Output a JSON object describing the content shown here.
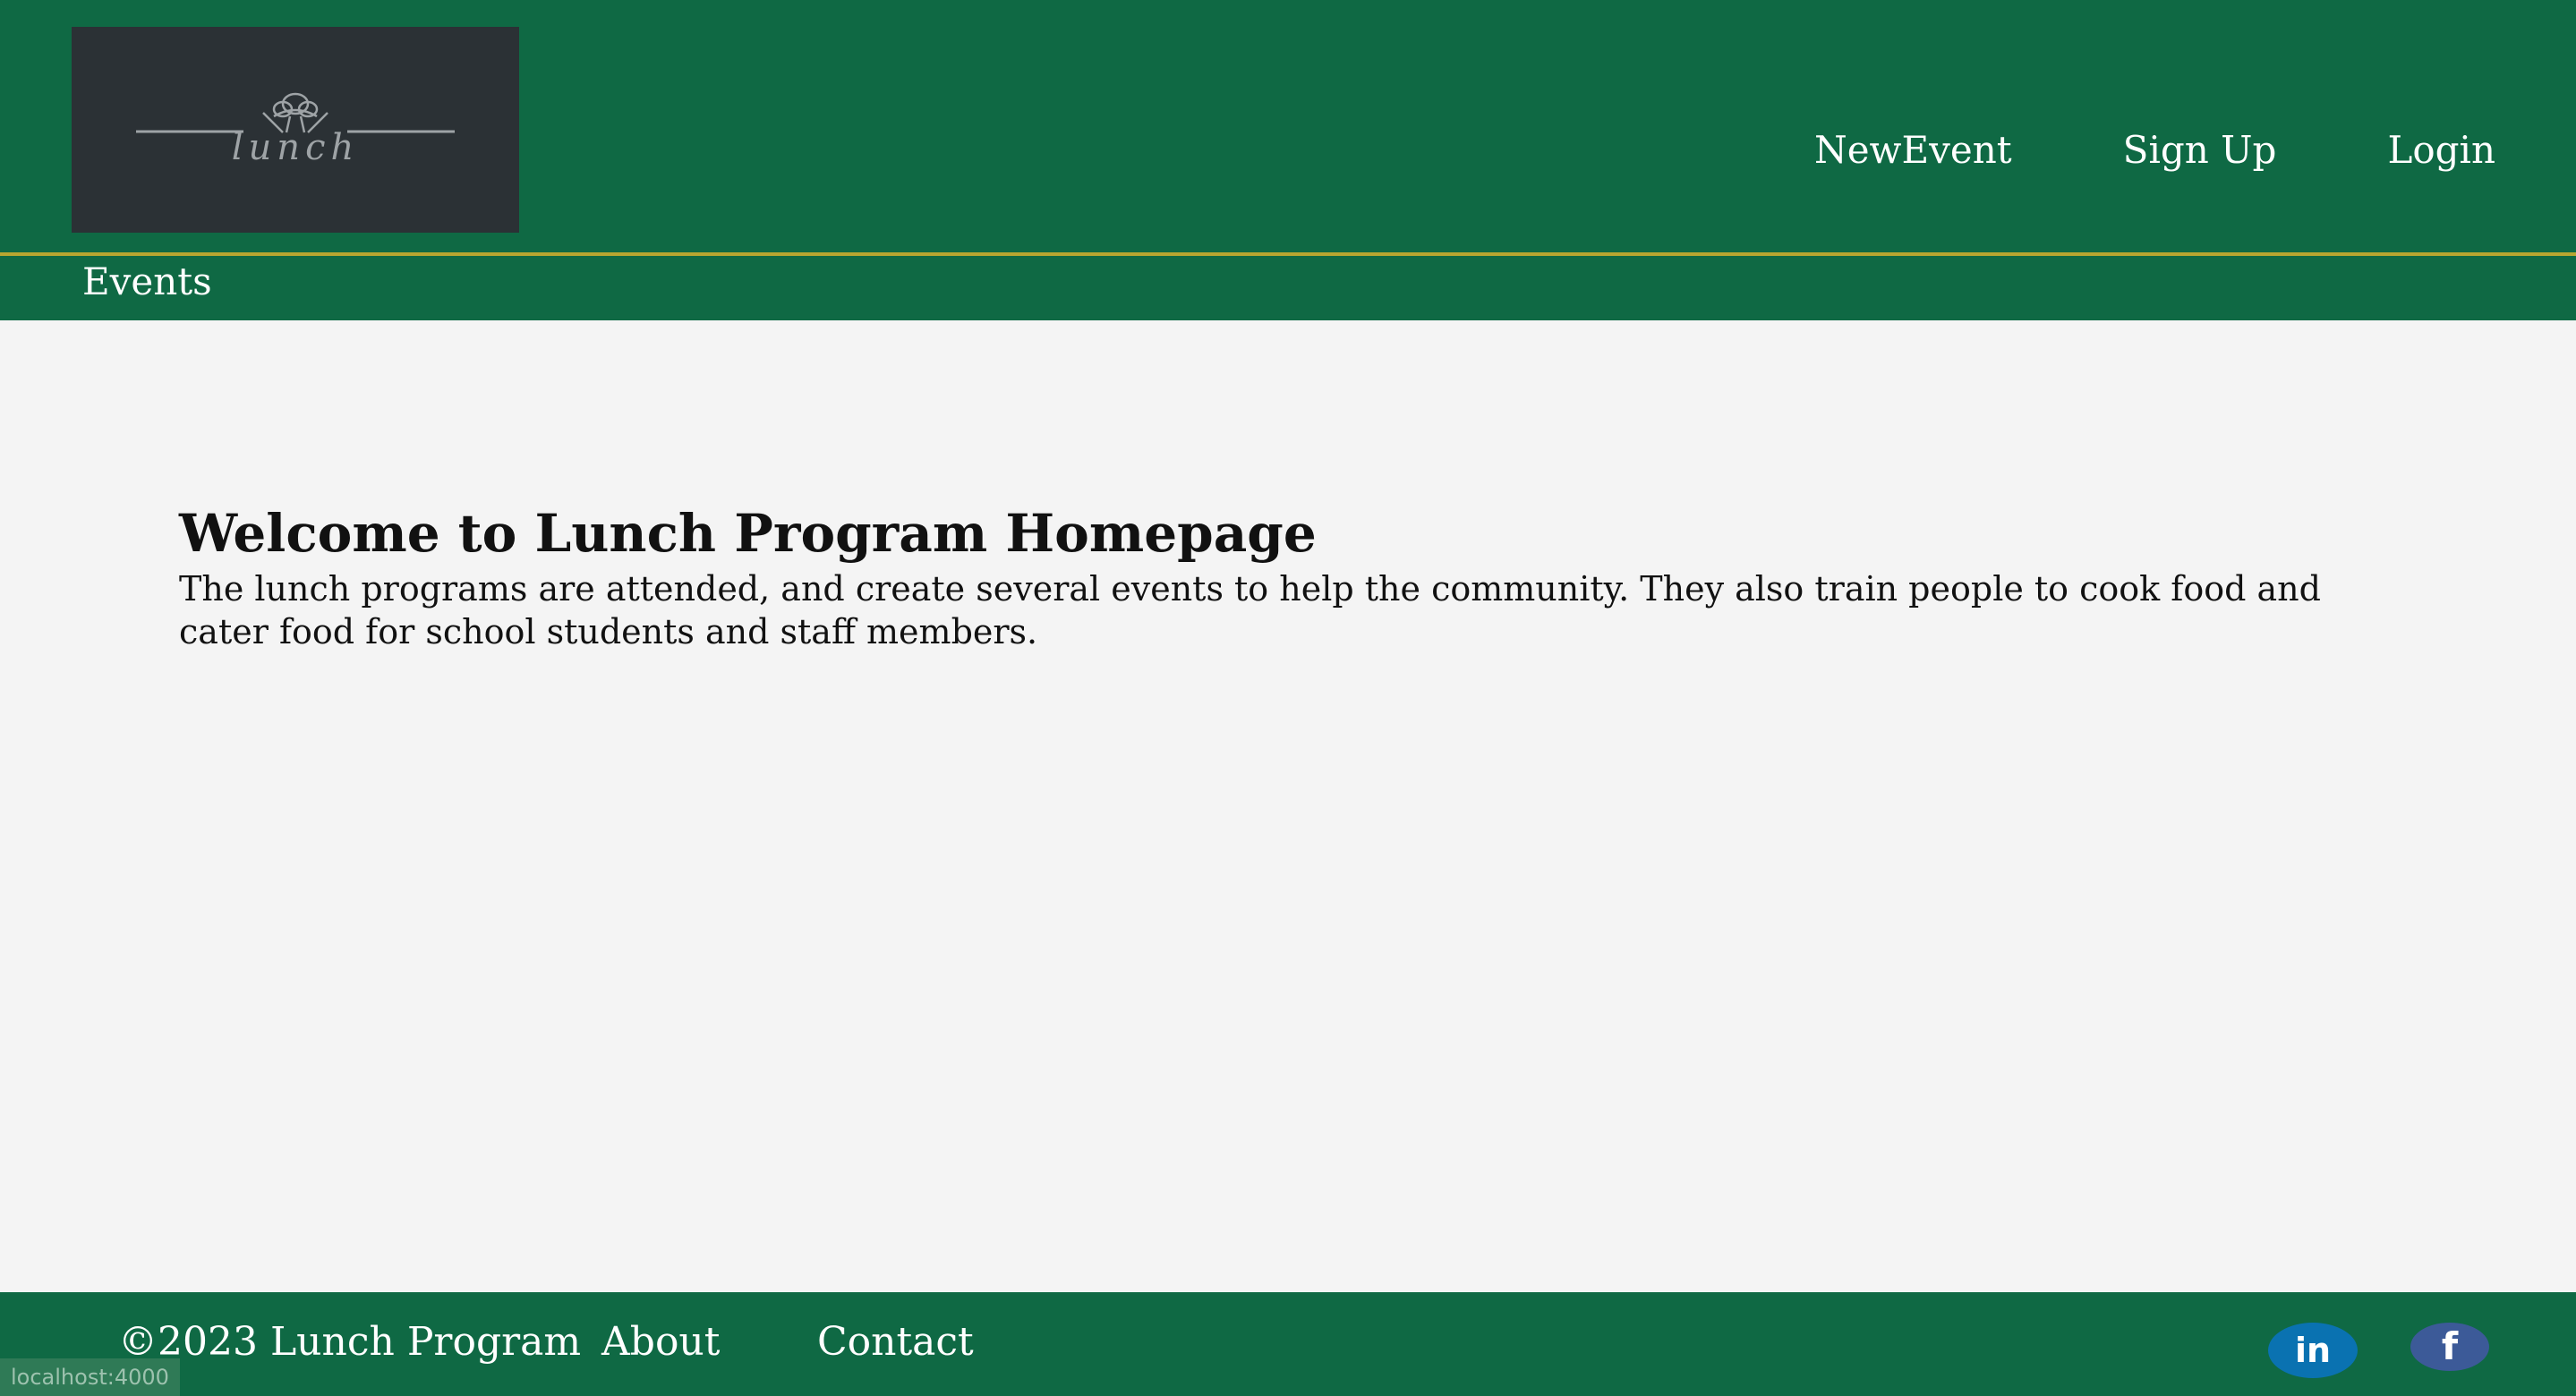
{
  "header": {
    "logo": {
      "text": "lunch",
      "icon": "chef-hat-icon"
    },
    "nav": [
      {
        "label": "NewEvent"
      },
      {
        "label": "Sign Up"
      },
      {
        "label": "Login"
      }
    ]
  },
  "subnav": {
    "events_label": "Events"
  },
  "main": {
    "title": "Welcome to Lunch Program Homepage",
    "body": "The lunch programs are attended, and create several events to help the community. They also train people to cook food and cater food for school students and staff members."
  },
  "footer": {
    "copyright": "©2023 Lunch Program",
    "about_label": "About",
    "contact_label": "Contact",
    "linkedin_text": "in",
    "facebook_text": "f"
  },
  "status_bar": {
    "url": "localhost:4000"
  },
  "colors": {
    "brand_green": "#0f6944",
    "gold_accent": "#b8a630",
    "logo_bg": "#2b3135",
    "linkedin_blue": "#0a72b1",
    "facebook_blue": "#3c5a98",
    "page_bg": "#f4f4f4"
  }
}
